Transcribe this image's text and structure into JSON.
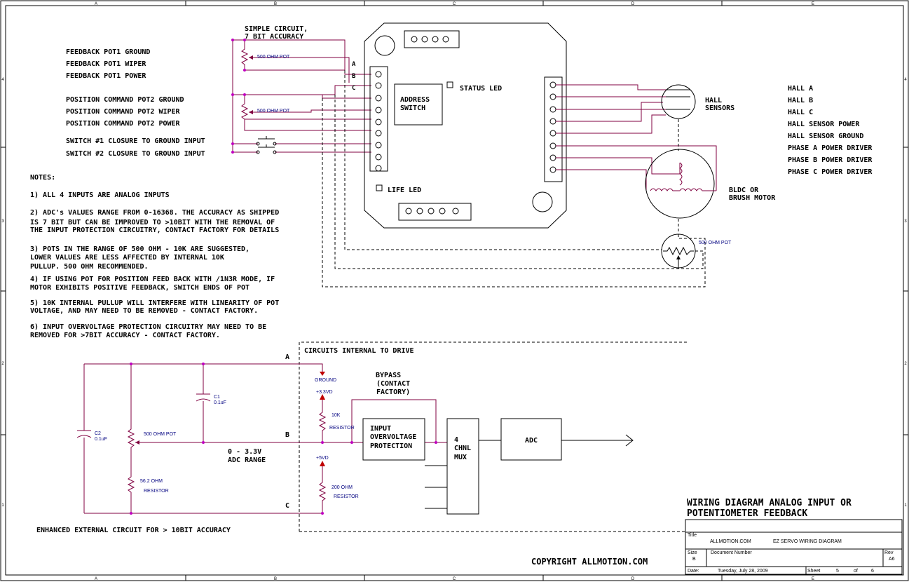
{
  "frame": {
    "col_labels": [
      "A",
      "B",
      "C",
      "D",
      "E"
    ],
    "row_labels": [
      "4",
      "3",
      "2",
      "1"
    ]
  },
  "top": {
    "simple_circuit": [
      "SIMPLE CIRCUIT,",
      "7 BIT ACCURACY"
    ],
    "feedback_pot": [
      "FEEDBACK POT1 GROUND",
      "FEEDBACK POT1 WIPER",
      "FEEDBACK POT1 POWER"
    ],
    "position_pot": [
      "POSITION COMMAND POT2 GROUND",
      "POSITION COMMAND POT2 WIPER",
      "POSITION COMMAND POT2 POWER"
    ],
    "switches": [
      "SWITCH #1 CLOSURE TO GROUND INPUT",
      "SWITCH #2 CLOSURE TO GROUND INPUT"
    ],
    "pot_label": "500 OHM POT",
    "abc": [
      "A",
      "B",
      "C"
    ],
    "address_switch": [
      "ADDRESS",
      "SWITCH"
    ],
    "status_led": "STATUS LED",
    "life_led": "LIFE LED",
    "hall_sensors": [
      "HALL",
      "SENSORS"
    ],
    "motor": [
      "BLDC  OR",
      "BRUSH MOTOR"
    ],
    "motor_pot": "500 OHM POT",
    "right_labels": [
      "HALL A",
      "HALL B",
      "HALL C",
      "HALL SENSOR POWER",
      "HALL SENSOR GROUND",
      "PHASE A POWER DRIVER",
      "PHASE B POWER DRIVER",
      "PHASE C POWER DRIVER"
    ]
  },
  "notes": {
    "heading": "NOTES:",
    "lines": [
      "1) ALL 4 INPUTS ARE ANALOG INPUTS",
      "2) ADC's VALUES RANGE FROM 0-16368. THE ACCURACY AS SHIPPED",
      "IS 7 BIT BUT CAN BE IMPROVED TO >10BIT WITH THE REMOVAL OF",
      "THE INPUT PROTECTION CIRCUITRY, CONTACT FACTORY FOR DETAILS",
      "3) POTS IN THE RANGE OF 500 OHM - 10K ARE SUGGESTED,",
      "LOWER VALUES ARE LESS AFFECTED BY INTERNAL 10K",
      "PULLUP. 500 OHM RECOMMENDED.",
      "4) IF USING POT FOR POSITION FEED BACK WITH /1N3R MODE, IF",
      " MOTOR EXHIBITS POSITIVE FEEDBACK, SWITCH ENDS OF POT",
      "5) 10K INTERNAL PULLUP WILL INTERFERE WITH LINEARITY OF POT",
      "VOLTAGE, AND MAY NEED TO BE REMOVED - CONTACT FACTORY.",
      "6) INPUT OVERVOLTAGE PROTECTION CIRCUITRY MAY NEED TO BE",
      "REMOVED FOR >7BIT ACCURACY - CONTACT FACTORY."
    ]
  },
  "bottom": {
    "internal_label": "CIRCUITS INTERNAL TO DRIVE",
    "c2": [
      "C2",
      "0.1uF"
    ],
    "c1": [
      "C1",
      "0.1uF"
    ],
    "pot": "500 OHM POT",
    "r562": [
      "56.2 OHM",
      "RESISTOR"
    ],
    "adc_range": [
      "0 - 3.3V",
      "ADC RANGE"
    ],
    "a": "A",
    "b": "B",
    "c": "C",
    "ground": "GROUND",
    "v33": "+3.3VD",
    "v5": "+5VD",
    "r10k": [
      "10K",
      "RESISTOR"
    ],
    "r200": [
      "200 OHM",
      "RESISTOR"
    ],
    "bypass": [
      "BYPASS",
      "(CONTACT",
      "FACTORY)"
    ],
    "protection": [
      "INPUT",
      "OVERVOLTAGE",
      "PROTECTION"
    ],
    "mux": [
      "4",
      "CHNL",
      "MUX"
    ],
    "adc": "ADC",
    "enhanced": "ENHANCED EXTERNAL CIRCUIT FOR > 10BIT ACCURACY",
    "copyright": "COPYRIGHT ALLMOTION.COM"
  },
  "title_block": {
    "title_lines": [
      "WIRING DIAGRAM ANALOG INPUT OR",
      "POTENTIOMETER FEEDBACK"
    ],
    "title_label": "Title",
    "company": "ALLMOTION.COM",
    "doc_title": "EZ SERVO WIRING DIAGRAM",
    "size_label": "Size",
    "size": "B",
    "doc_number_label": "Document Number",
    "rev_label": "Rev",
    "rev": "A6",
    "date_label": "Date:",
    "date": "Tuesday, July 28, 2009",
    "sheet_label": "Sheet",
    "sheet": "5",
    "of_label": "of",
    "of": "6"
  }
}
